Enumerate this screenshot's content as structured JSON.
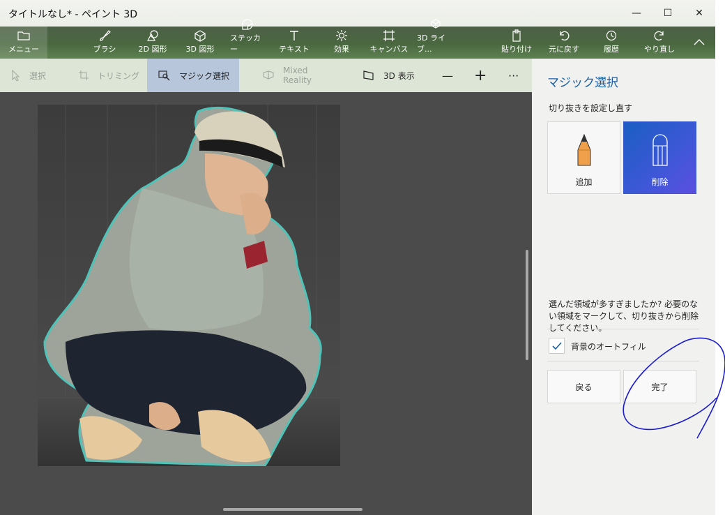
{
  "window": {
    "title": "タイトルなし* - ペイント 3D",
    "minimize_glyph": "—",
    "maximize_glyph": "☐",
    "close_glyph": "✕"
  },
  "ribbon": {
    "menu": "メニュー",
    "tools": [
      "ブラシ",
      "2D 図形",
      "3D 図形",
      "ステッカー",
      "テキスト",
      "効果",
      "キャンバス",
      "3D ライブ..."
    ],
    "paste": "貼り付け",
    "undo": "元に戻す",
    "history": "履歴",
    "redo": "やり直し"
  },
  "subbar": {
    "select": "選択",
    "crop": "トリミング",
    "magic_select": "マジック選択",
    "mixed_reality": "Mixed Reality",
    "view_3d": "3D 表示",
    "zoom_out": "—",
    "zoom_in": "+",
    "more": "···"
  },
  "panel": {
    "title": "マジック選択",
    "subtitle": "切り抜きを設定し直す",
    "add_label": "追加",
    "remove_label": "削除",
    "description": "選んだ領域が多すぎましたか? 必要のない領域をマークして、切り抜きから削除してください。",
    "autofill_label": "背景のオートフィル",
    "autofill_checked": true,
    "back_label": "戻る",
    "done_label": "完了"
  },
  "colors": {
    "accent": "#1a5fa6",
    "selected_card": "#3f57d8",
    "ribbon": "#4a6840",
    "selection_outline": "#4fc3b8",
    "scribble": "#1c1ccf"
  }
}
